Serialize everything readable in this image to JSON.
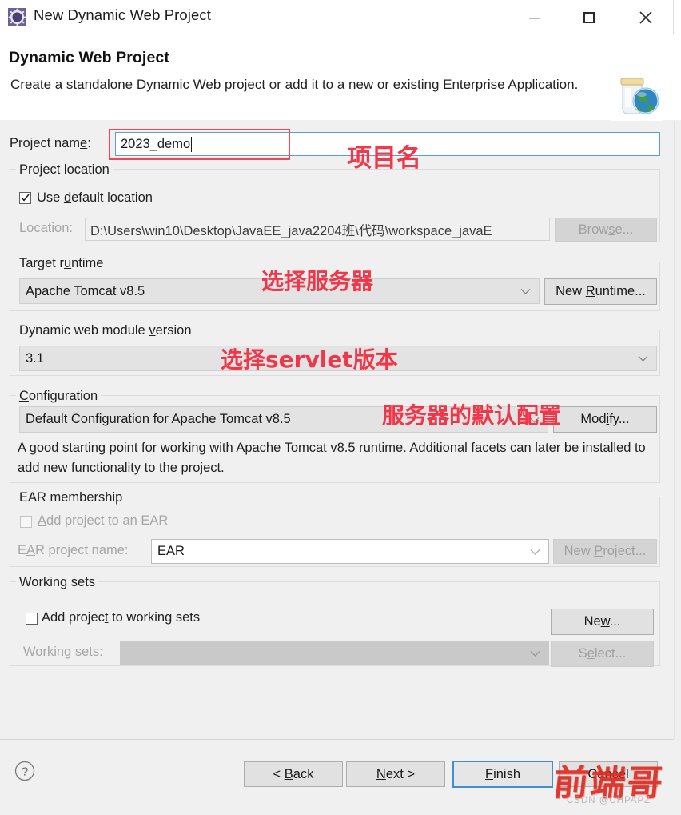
{
  "window": {
    "title": "New Dynamic Web Project",
    "app_icon": "eclipse-project-icon",
    "controls": {
      "minimize": "minimize-icon",
      "maximize": "maximize-icon",
      "close": "close-icon"
    }
  },
  "header": {
    "title": "Dynamic Web Project",
    "description": "Create a standalone Dynamic Web project or add it to a new or existing Enterprise Application.",
    "banner_icon": "jar-globe-icon"
  },
  "project_name": {
    "label": "Project name:",
    "value": "2023_demo",
    "placeholder": ""
  },
  "project_location": {
    "group_title": "Project location",
    "use_default_label": "Use default location",
    "use_default_checked": true,
    "location_label": "Location:",
    "location_value": "D:\\Users\\win10\\Desktop\\JavaEE_java2204班\\代码\\workspace_javaE",
    "browse_label": "Browse..."
  },
  "target_runtime": {
    "group_title": "Target runtime",
    "value": "Apache Tomcat v8.5",
    "new_runtime_label": "New Runtime..."
  },
  "module_version": {
    "group_title": "Dynamic web module version",
    "value": "3.1"
  },
  "configuration": {
    "group_title": "Configuration",
    "value": "Default Configuration for Apache Tomcat v8.5",
    "modify_label": "Modify...",
    "description": "A good starting point for working with Apache Tomcat v8.5 runtime. Additional facets can later be installed to add new functionality to the project."
  },
  "ear_membership": {
    "group_title": "EAR membership",
    "add_project_label": "Add project to an EAR",
    "add_project_checked": false,
    "ear_name_label": "EAR project name:",
    "ear_name_value": "EAR",
    "new_project_label": "New Project..."
  },
  "working_sets": {
    "group_title": "Working sets",
    "add_project_label": "Add project to working sets",
    "add_project_checked": false,
    "new_label": "New...",
    "working_sets_label": "Working sets:",
    "working_sets_value": ""
  },
  "footer": {
    "help_icon": "help-question-icon",
    "back_label": "< Back",
    "next_label": "Next >",
    "finish_label": "Finish",
    "cancel_label": "Cancel"
  },
  "annotations": [
    {
      "text": "项目名",
      "target": "project-name"
    },
    {
      "text": "选择服务器",
      "target": "target-runtime"
    },
    {
      "text": "选择servlet版本",
      "target": "module-version"
    },
    {
      "text": "服务器的默认配置",
      "target": "configuration"
    }
  ],
  "watermark": {
    "text": "前端哥",
    "credit": "CSDN @CHPAPZ"
  },
  "colors": {
    "annotation_red": "#f2283c",
    "focus_blue": "#3e8fd6",
    "dialog_bg": "#f0f0f0"
  }
}
